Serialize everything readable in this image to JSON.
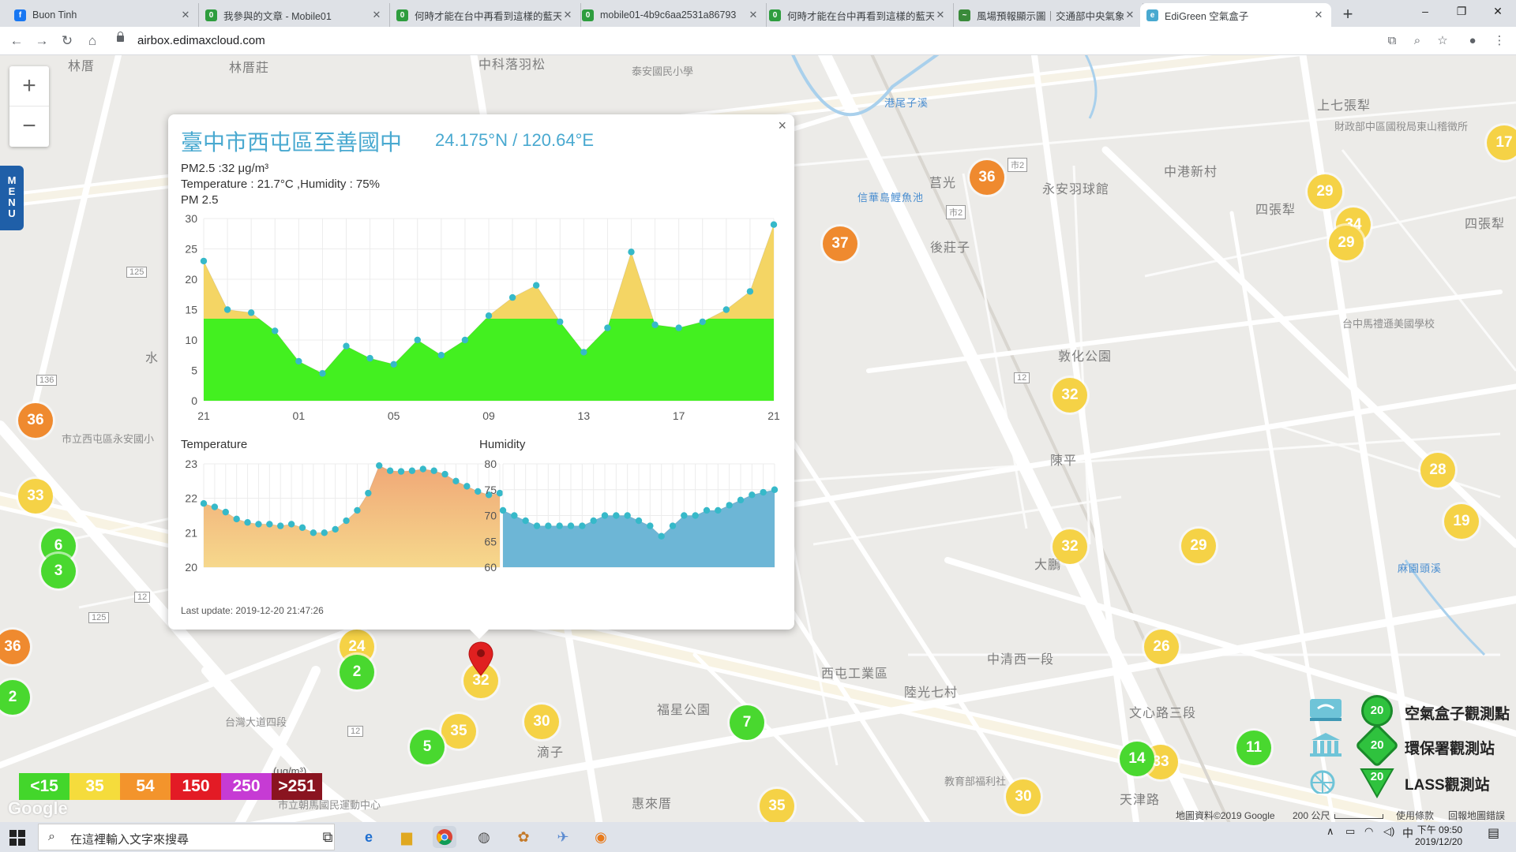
{
  "browser": {
    "tabs": [
      {
        "label": "Buon Tinh",
        "icon": "facebook-icon",
        "color": "#1877f2",
        "glyph": "f"
      },
      {
        "label": "我參與的文章 - Mobile01",
        "icon": "mobile01-icon",
        "color": "#2e9d3e",
        "glyph": "0"
      },
      {
        "label": "何時才能在台中再看到這樣的藍天",
        "icon": "mobile01-icon",
        "color": "#2e9d3e",
        "glyph": "0"
      },
      {
        "label": "mobile01-4b9c6aa2531a86793",
        "icon": "mobile01-icon",
        "color": "#2e9d3e",
        "glyph": "0"
      },
      {
        "label": "何時才能在台中再看到這樣的藍天",
        "icon": "mobile01-icon",
        "color": "#2e9d3e",
        "glyph": "0"
      },
      {
        "label": "風場預報顯示圖｜交通部中央氣象",
        "icon": "cwb-icon",
        "color": "#3a8a3a",
        "glyph": "~"
      },
      {
        "label": "EdiGreen 空氣盒子",
        "icon": "edigreen-icon",
        "color": "#49a9d0",
        "glyph": "e"
      }
    ],
    "new_tab": "+",
    "window_controls": [
      "–",
      "❐",
      "✕"
    ],
    "url": "airbox.edimaxcloud.com"
  },
  "map": {
    "labels": [
      {
        "text": "林厝",
        "x": 86,
        "y": 70
      },
      {
        "text": "林厝莊",
        "x": 290,
        "y": 72
      },
      {
        "text": "中科落羽松",
        "x": 606,
        "y": 68
      },
      {
        "text": "泰安國民小學",
        "x": 800,
        "y": 80
      },
      {
        "text": "上七張犁",
        "x": 1668,
        "y": 120
      },
      {
        "text": "財政部中區國稅局東山稽徵所",
        "x": 1690,
        "y": 150
      },
      {
        "text": "中港新村",
        "x": 1474,
        "y": 204
      },
      {
        "text": "四張犁",
        "x": 1590,
        "y": 252
      },
      {
        "text": "四張犁",
        "x": 1855,
        "y": 270
      },
      {
        "text": "莒光",
        "x": 1177,
        "y": 218
      },
      {
        "text": "永安羽球館",
        "x": 1320,
        "y": 226
      },
      {
        "text": "後莊子",
        "x": 1178,
        "y": 300
      },
      {
        "text": "敦化公園",
        "x": 1340,
        "y": 438
      },
      {
        "text": "陳平",
        "x": 1330,
        "y": 570
      },
      {
        "text": "台中馬禮遜美國學校",
        "x": 1700,
        "y": 400
      },
      {
        "text": "市立西屯區永安國小",
        "x": 78,
        "y": 546
      },
      {
        "text": "大鵬",
        "x": 1310,
        "y": 702
      },
      {
        "text": "西屯工業區",
        "x": 1040,
        "y": 840
      },
      {
        "text": "陸光七村",
        "x": 1145,
        "y": 864
      },
      {
        "text": "福星公園",
        "x": 832,
        "y": 886
      },
      {
        "text": "滴子",
        "x": 680,
        "y": 940
      },
      {
        "text": "惠來厝",
        "x": 800,
        "y": 1005
      },
      {
        "text": "市立朝馬國民運動中心",
        "x": 352,
        "y": 1010
      },
      {
        "text": "教育部福利社",
        "x": 1196,
        "y": 980
      },
      {
        "text": "天津路",
        "x": 1418,
        "y": 1000
      },
      {
        "text": "中清西一段",
        "x": 1250,
        "y": 822
      },
      {
        "text": "文心路三段",
        "x": 1430,
        "y": 890
      },
      {
        "text": "台灣大道四段",
        "x": 285,
        "y": 905
      },
      {
        "text": "水",
        "x": 184,
        "y": 440
      }
    ],
    "blue_labels": [
      {
        "text": "信華島鯉魚池",
        "x": 1086,
        "y": 240
      },
      {
        "text": "港尾子溪",
        "x": 1120,
        "y": 120
      },
      {
        "text": "麻園頭溪",
        "x": 1770,
        "y": 710
      }
    ],
    "markers": [
      {
        "v": "36",
        "c": "orange",
        "x": 1250,
        "y": 225
      },
      {
        "v": "37",
        "c": "orange",
        "x": 1064,
        "y": 309
      },
      {
        "v": "29",
        "c": "yellow",
        "x": 1678,
        "y": 243
      },
      {
        "v": "34",
        "c": "yellow",
        "x": 1714,
        "y": 285
      },
      {
        "v": "29",
        "c": "yellow",
        "x": 1705,
        "y": 308
      },
      {
        "v": "17",
        "c": "yellow",
        "x": 1905,
        "y": 181
      },
      {
        "v": "36",
        "c": "orange",
        "x": 45,
        "y": 533
      },
      {
        "v": "33",
        "c": "yellow",
        "x": 45,
        "y": 629
      },
      {
        "v": "6",
        "c": "green",
        "x": 74,
        "y": 692
      },
      {
        "v": "3",
        "c": "green",
        "x": 74,
        "y": 724
      },
      {
        "v": "32",
        "c": "yellow",
        "x": 1355,
        "y": 501
      },
      {
        "v": "28",
        "c": "yellow",
        "x": 1821,
        "y": 596
      },
      {
        "v": "19",
        "c": "yellow",
        "x": 1851,
        "y": 661
      },
      {
        "v": "32",
        "c": "yellow",
        "x": 1355,
        "y": 693
      },
      {
        "v": "29",
        "c": "yellow",
        "x": 1518,
        "y": 692
      },
      {
        "v": "36",
        "c": "orange",
        "x": 16,
        "y": 820
      },
      {
        "v": "2",
        "c": "green",
        "x": 16,
        "y": 884
      },
      {
        "v": "24",
        "c": "yellow",
        "x": 452,
        "y": 820
      },
      {
        "v": "2",
        "c": "green",
        "x": 452,
        "y": 852
      },
      {
        "v": "32",
        "c": "yellow",
        "x": 609,
        "y": 863
      },
      {
        "v": "35",
        "c": "yellow",
        "x": 581,
        "y": 927
      },
      {
        "v": "30",
        "c": "yellow",
        "x": 686,
        "y": 915
      },
      {
        "v": "5",
        "c": "green",
        "x": 541,
        "y": 947
      },
      {
        "v": "7",
        "c": "green",
        "x": 946,
        "y": 916
      },
      {
        "v": "26",
        "c": "yellow",
        "x": 1471,
        "y": 820
      },
      {
        "v": "11",
        "c": "green",
        "x": 1588,
        "y": 948
      },
      {
        "v": "33",
        "c": "yellow",
        "x": 1470,
        "y": 966
      },
      {
        "v": "14",
        "c": "green",
        "x": 1440,
        "y": 962
      },
      {
        "v": "30",
        "c": "yellow",
        "x": 1296,
        "y": 1010
      },
      {
        "v": "35",
        "c": "yellow",
        "x": 984,
        "y": 1022
      }
    ],
    "route_shields": [
      "125",
      "136",
      "125",
      "12",
      "12",
      "12",
      "市2",
      "市2"
    ]
  },
  "zoom": {
    "in": "+",
    "out": "−"
  },
  "menu_label": "MENU",
  "popup": {
    "title": "臺中市西屯區至善國中",
    "coords": "24.175°N / 120.64°E",
    "pm25_line": "PM2.5 :32 μg/m³",
    "weather_line": "Temperature : 21.7°C ,Humidity : 75%",
    "chart_label": "PM 2.5",
    "temperature_label": "Temperature",
    "humidity_label": "Humidity",
    "last_update": "Last update: 2019-12-20 21:47:26",
    "close": "×"
  },
  "chart_data": [
    {
      "type": "area",
      "title": "PM 2.5",
      "x_tick_labels": [
        "21",
        "01",
        "05",
        "09",
        "13",
        "17",
        "21"
      ],
      "ylim": [
        0,
        30
      ],
      "y_ticks": [
        0,
        5,
        10,
        15,
        20,
        25,
        30
      ],
      "threshold": 13.5,
      "values": [
        23,
        15,
        14.5,
        11.5,
        6.5,
        4.5,
        9,
        7,
        6,
        10,
        7.5,
        10,
        14,
        17,
        19,
        13,
        8,
        12,
        24.5,
        12.5,
        12,
        13,
        15,
        18,
        29
      ],
      "colors": {
        "below": "#43f020",
        "above": "#f4d564",
        "point": "#36b9c9"
      }
    },
    {
      "type": "area",
      "title": "Temperature",
      "ylim": [
        20,
        23
      ],
      "y_ticks": [
        20,
        21,
        22,
        23
      ],
      "values": [
        21.85,
        21.75,
        21.6,
        21.4,
        21.3,
        21.25,
        21.25,
        21.2,
        21.25,
        21.15,
        21.0,
        21.0,
        21.1,
        21.35,
        21.65,
        22.15,
        22.95,
        22.8,
        22.78,
        22.8,
        22.85,
        22.8,
        22.7,
        22.5,
        22.35,
        22.2,
        22.1,
        22.15
      ],
      "colors": {
        "fill_top": "#f0a877",
        "fill_bottom": "#f6d88c",
        "point": "#36b9c9"
      }
    },
    {
      "type": "area",
      "title": "Humidity",
      "ylim": [
        60,
        80
      ],
      "y_ticks": [
        60,
        65,
        70,
        75,
        80
      ],
      "values": [
        71,
        70,
        69,
        68,
        68,
        68,
        68,
        68,
        69,
        70,
        70,
        70,
        69,
        68,
        66,
        68,
        70,
        70,
        71,
        71,
        72,
        73,
        74,
        74.5,
        75
      ],
      "colors": {
        "fill": "#6db6d6",
        "point": "#36b9c9"
      }
    }
  ],
  "aqi_legend": [
    {
      "label": "<15",
      "color": "#43d62b"
    },
    {
      "label": "35",
      "color": "#f5dc3c"
    },
    {
      "label": "54",
      "color": "#f3942c"
    },
    {
      "label": "150",
      "color": "#e31b25"
    },
    {
      "label": "250",
      "color": "#c63bd4"
    },
    {
      "label": ">251",
      "color": "#8a1420"
    }
  ],
  "unit_label": "(μg/m³)",
  "google_label": "Google",
  "station_legend": [
    {
      "badge": "20",
      "label": "空氣盒子觀測點",
      "icon": "airbox-icon",
      "shape": "circle"
    },
    {
      "badge": "20",
      "label": "環保署觀測站",
      "icon": "epa-building-icon",
      "shape": "diamond"
    },
    {
      "badge": "20",
      "label": "LASS觀測站",
      "icon": "lass-icon",
      "shape": "triangle"
    }
  ],
  "attribution": {
    "map_data": "地圖資料©2019 Google",
    "scale": "200 公尺",
    "terms": "使用條款",
    "report": "回報地圖錯誤"
  },
  "taskbar": {
    "search_placeholder": "在這裡輸入文字來搜尋",
    "time": "下午 09:50",
    "date": "2019/12/20",
    "ime": "中"
  }
}
